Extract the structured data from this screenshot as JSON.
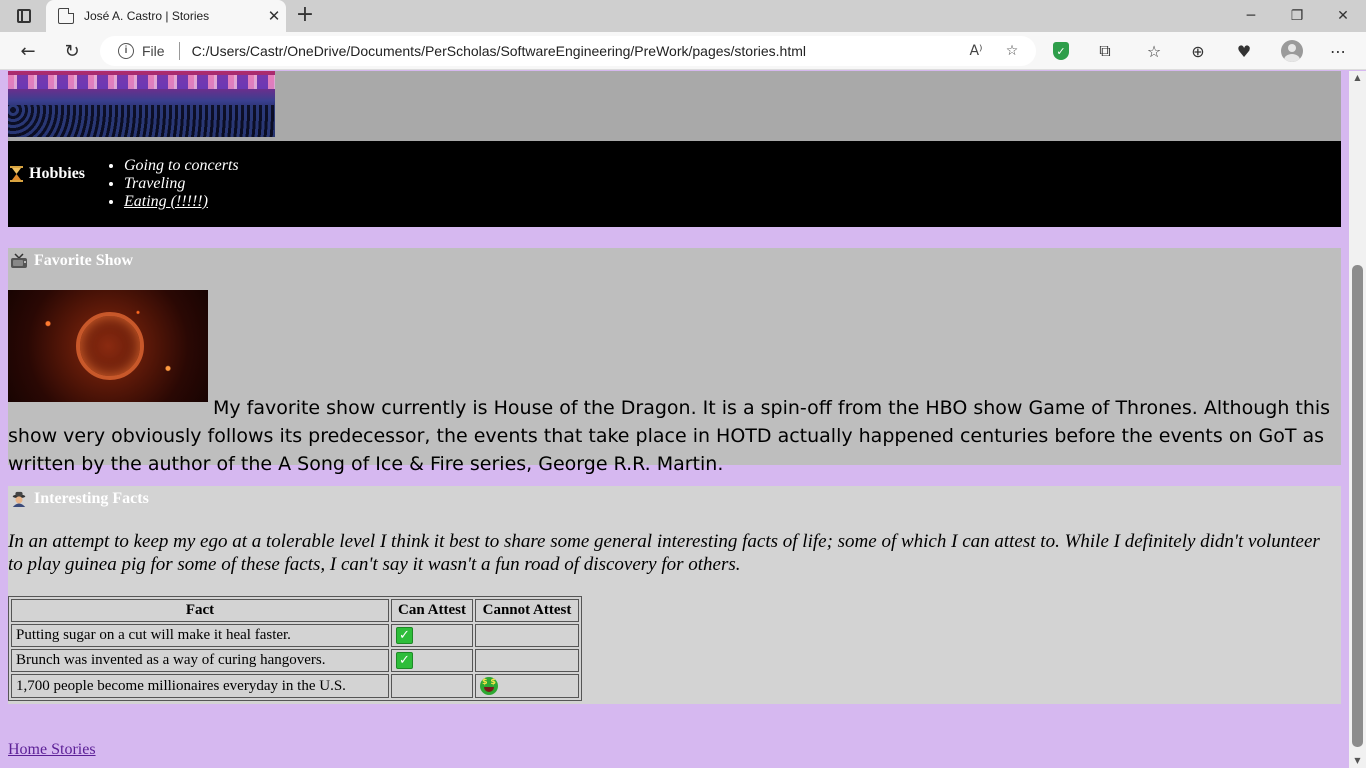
{
  "browser": {
    "tab_title": "José A. Castro | Stories",
    "address_label": "File",
    "url": "C:/Users/Castr/OneDrive/Documents/PerScholas/SoftwareEngineering/PreWork/pages/stories.html"
  },
  "hobbies": {
    "heading": "Hobbies",
    "items": [
      "Going to concerts",
      "Traveling",
      "Eating (!!!!!)"
    ]
  },
  "favorite_show": {
    "heading": "Favorite Show",
    "text": "My favorite show currently is House of the Dragon. It is a spin-off from the HBO show Game of Thrones. Although this show very obviously follows its predecessor, the events that take place in HOTD actually happened centuries before the events on GoT as written by the author of the A Song of Ice & Fire series, George R.R. Martin."
  },
  "interesting_facts": {
    "heading": "Interesting Facts",
    "intro": "In an attempt to keep my ego at a tolerable level I think it best to share some general interesting facts of life; some of which I can attest to. While I definitely didn't volunteer to play guinea pig for some of these facts, I can't say it wasn't a fun road of discovery for others.",
    "table": {
      "headers": [
        "Fact",
        "Can Attest",
        "Cannot Attest"
      ],
      "rows": [
        {
          "fact": "Putting sugar on a cut will make it heal faster.",
          "can": true,
          "cannot": false
        },
        {
          "fact": "Brunch was invented as a way of curing hangovers.",
          "can": true,
          "cannot": false
        },
        {
          "fact": "1,700 people become millionaires everyday in the U.S.",
          "can": false,
          "cannot": true
        }
      ]
    }
  },
  "footer": {
    "home_link": "Home Stories"
  },
  "colors": {
    "page_bg": "#d6b8f0",
    "hobbies_bg": "#000000",
    "fav_show_bg": "#bebebe",
    "facts_bg": "#d3d3d3",
    "link": "#5b1f96"
  }
}
